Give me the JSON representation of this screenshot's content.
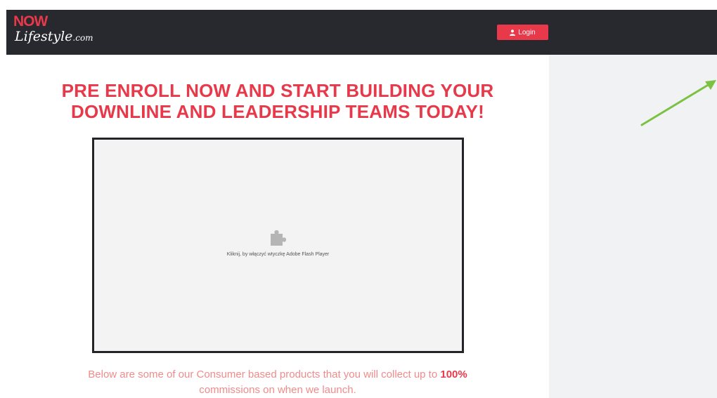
{
  "header": {
    "logo_now": "NOW",
    "logo_lifestyle": "Lifestyle",
    "logo_com": ".com",
    "login_label": "Login",
    "login_icon": "user-icon"
  },
  "main": {
    "headline_line1": "PRE ENROLL NOW AND START BUILDING YOUR",
    "headline_line2": "DOWNLINE AND LEADERSHIP TEAMS TODAY!",
    "plugin_icon": "puzzle-icon",
    "plugin_message": "Kliknij, by włączyć wtyczkę Adobe Flash Player",
    "below_text_before": "Below are some of our Consumer based products that you will collect up to ",
    "below_text_bold": "100%",
    "below_text_after": " commissions on when we launch."
  },
  "colors": {
    "accent": "#e8394a",
    "header_bg": "#27292e",
    "sidebar_bg": "#f1f2f4",
    "arrow": "#7cc242"
  }
}
